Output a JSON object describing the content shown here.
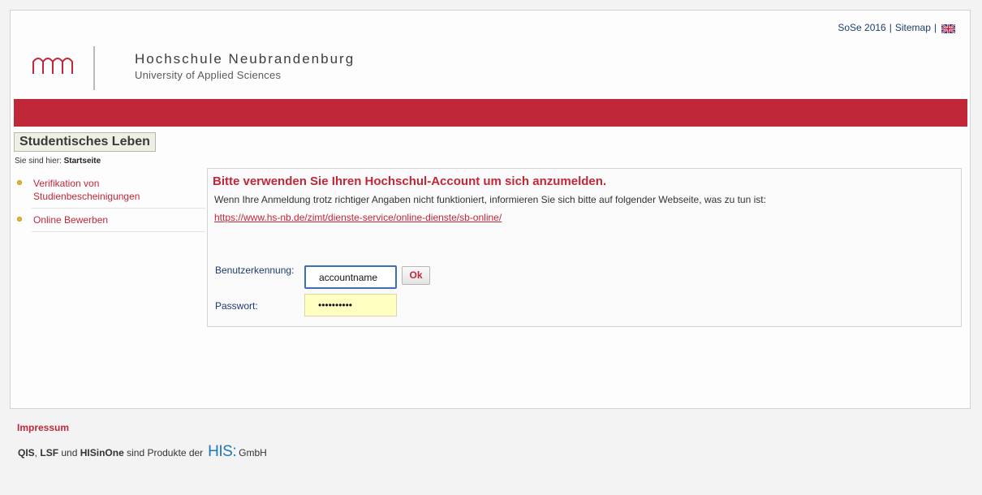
{
  "topnav": {
    "semester": "SoSe 2016",
    "separator": "|",
    "sitemap": "Sitemap"
  },
  "logo": {
    "name": "Hochschule Neubrandenburg",
    "subtitle": "University of Applied Sciences"
  },
  "colors": {
    "brand_red": "#c0283a",
    "nav_blue": "#1d3c6e",
    "password_bg": "#ffffc2",
    "his_blue": "#1f78b4"
  },
  "section": {
    "title": "Studentisches Leben"
  },
  "breadcrumb": {
    "prefix": "Sie sind hier:",
    "current": "Startseite"
  },
  "sidebar": {
    "items": [
      {
        "label_line1": "Verifikation von",
        "label_line2": "Studienbescheinigungen"
      },
      {
        "label_line1": "Online Bewerben"
      }
    ]
  },
  "login": {
    "headline": "Bitte verwenden Sie Ihren Hochschul-Account um sich anzumelden.",
    "info": "Wenn Ihre Anmeldung trotz richtiger Angaben nicht funktioniert, informieren Sie sich bitte auf folgender Webseite, was zu tun ist:",
    "link": "https://www.hs-nb.de/zimt/dienste-service/online-dienste/sb-online/",
    "username_label": "Benutzerkennung:",
    "username_value": "accountname",
    "password_label": "Passwort:",
    "password_value": "••••••••••",
    "ok_label": "Ok"
  },
  "footer": {
    "impressum": "Impressum",
    "product_qis": "QIS",
    "comma": ",",
    "product_lsf": "LSF",
    "und": "und",
    "product_hisinone": "HISinOne",
    "text_mid": "sind Produkte der",
    "his_logo": "HIS:",
    "text_end": "GmbH"
  }
}
